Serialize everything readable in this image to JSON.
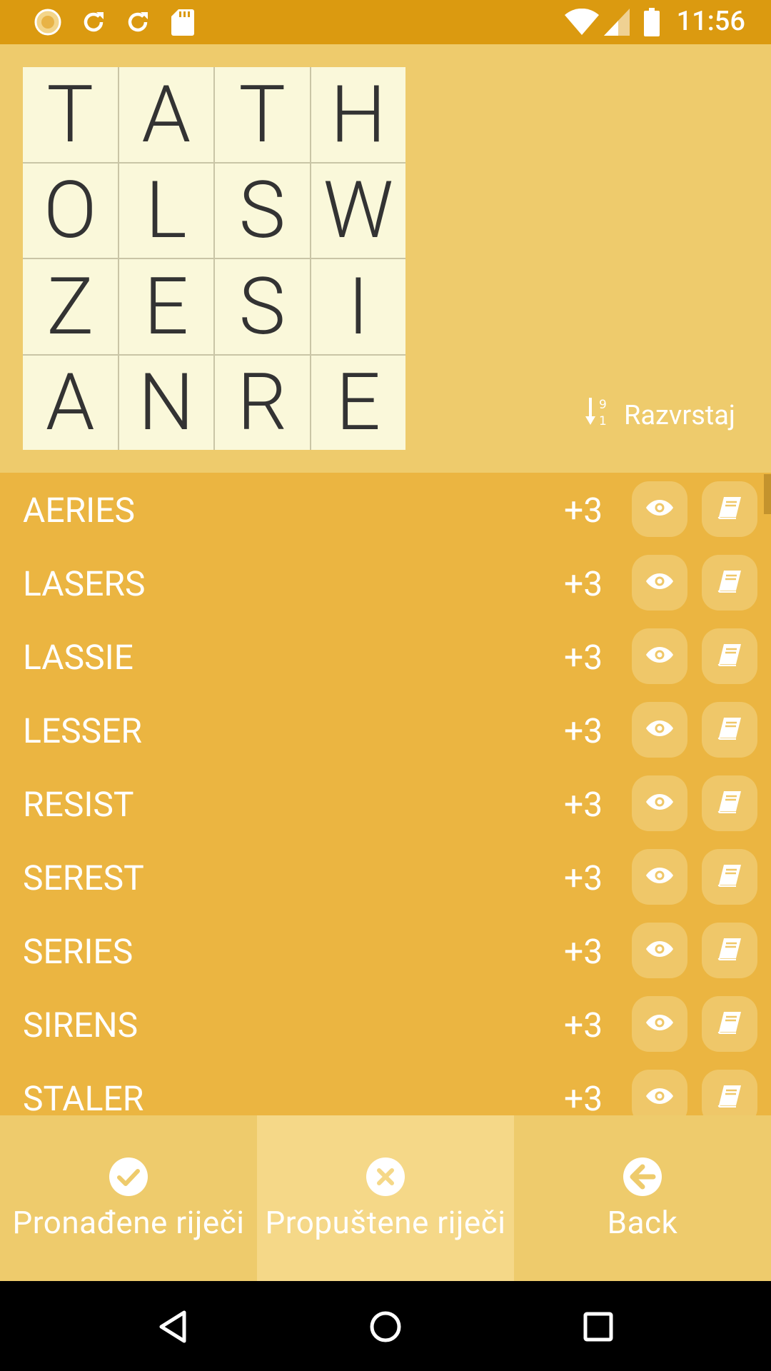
{
  "status_bar": {
    "time": "11:56",
    "icons": [
      "sun-icon",
      "refresh-icon",
      "refresh-icon",
      "sd-card-icon",
      "wifi-icon",
      "signal-icon",
      "battery-icon"
    ]
  },
  "board": {
    "rows": [
      [
        "T",
        "A",
        "T",
        "H"
      ],
      [
        "O",
        "L",
        "S",
        "W"
      ],
      [
        "Z",
        "E",
        "S",
        "I"
      ],
      [
        "A",
        "N",
        "R",
        "E"
      ]
    ]
  },
  "sort": {
    "label": "Razvrstaj",
    "icon": "sort-numeric-icon"
  },
  "words": [
    {
      "word": "AERIES",
      "score": "+3"
    },
    {
      "word": "LASERS",
      "score": "+3"
    },
    {
      "word": "LASSIE",
      "score": "+3"
    },
    {
      "word": "LESSER",
      "score": "+3"
    },
    {
      "word": "RESIST",
      "score": "+3"
    },
    {
      "word": "SEREST",
      "score": "+3"
    },
    {
      "word": "SERIES",
      "score": "+3"
    },
    {
      "word": "SIRENS",
      "score": "+3"
    },
    {
      "word": "STALER",
      "score": "+3"
    }
  ],
  "bottom_nav": [
    {
      "label": "Pronađene riječi",
      "icon": "check-circle-icon",
      "active": false
    },
    {
      "label": "Propuštene riječi",
      "icon": "x-circle-icon",
      "active": true
    },
    {
      "label": "Back",
      "icon": "arrow-left-circle-icon",
      "active": false
    }
  ],
  "colors": {
    "status_bar": "#DB9A10",
    "top_panel": "#EECB6C",
    "list_bg": "#EBB541",
    "cell_bg": "#FAF8DA",
    "nav_active": "#F5D888"
  }
}
